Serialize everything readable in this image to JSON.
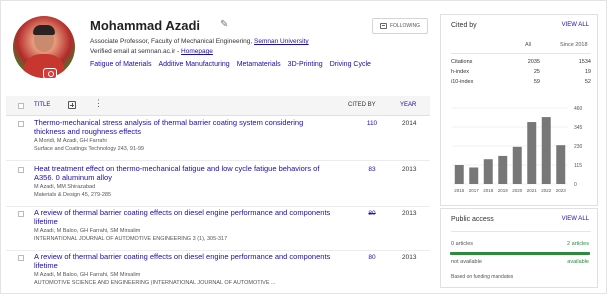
{
  "profile": {
    "name": "Mohammad Azadi",
    "affiliation_prefix": "Associate Professor, Faculty of Mechanical Engineering, ",
    "affiliation_link": "Semnan University",
    "verified_prefix": "Verified email at semnan.ac.ir - ",
    "homepage_label": "Homepage",
    "follow_label": "FOLLOWING",
    "interests": [
      "Fatigue of Materials",
      "Additive Manufacturing",
      "Metamaterials",
      "3D-Printing",
      "Driving Cycle"
    ]
  },
  "table": {
    "title_label": "TITLE",
    "cited_label": "CITED BY",
    "year_label": "YEAR",
    "rows": [
      {
        "title": "Thermo-mechanical stress analysis of thermal barrier coating system considering thickness and roughness effects",
        "authors": "A Moridi, M Azadi, GH Farrahi",
        "venue": "Surface and Coatings Technology 243, 91-99",
        "cited": "110",
        "year": "2014"
      },
      {
        "title": "Heat treatment effect on thermo-mechanical fatigue and low cycle fatigue behaviors of A356. 0 aluminum alloy",
        "authors": "M Azadi, MM Shirazabad",
        "venue": "Materials & Design 45, 279-285",
        "cited": "83",
        "year": "2013"
      },
      {
        "title": "A review of thermal barrier coating effects on diesel engine performance and components lifetime",
        "authors": "M Azadi, M Baloo, GH Farrahi, SM Mirsalim",
        "venue": "INTERNATIONAL JOURNAL OF AUTOMOTIVE ENGINEERING 3 (1), 305-317",
        "cited": "80",
        "year": "2013"
      },
      {
        "title": "A review of thermal barrier coating effects on diesel engine performance and components lifetime",
        "authors": "M Azadi, M Baloo, GH Farrahi, SM Mirsalim",
        "venue": "AUTOMOTIVE SCIENCE AND ENGINEERING (INTERNATIONAL JOURNAL OF AUTOMOTIVE ...",
        "cited": "80",
        "year": "2013"
      }
    ]
  },
  "cited_by": {
    "title": "Cited by",
    "view_all": "VIEW ALL",
    "col_all": "All",
    "col_since": "Since 2018",
    "metrics": [
      {
        "label": "Citations",
        "all": "2035",
        "since": "1534"
      },
      {
        "label": "h-index",
        "all": "25",
        "since": "19"
      },
      {
        "label": "i10-index",
        "all": "59",
        "since": "52"
      }
    ]
  },
  "chart_data": {
    "type": "bar",
    "categories": [
      "2016",
      "2017",
      "2018",
      "2019",
      "2020",
      "2021",
      "2022",
      "2023"
    ],
    "values": [
      115,
      100,
      150,
      170,
      225,
      375,
      405,
      235
    ],
    "yticks": [
      "460",
      "345",
      "230",
      "115",
      "0"
    ],
    "ylim": [
      0,
      460
    ],
    "bar_color": "#777777"
  },
  "public_access": {
    "title": "Public access",
    "view_all": "VIEW ALL",
    "left_label": "0 articles",
    "right_label": "2 articles",
    "not_available": "not available",
    "available": "available",
    "available_fraction": 1.0,
    "footer": "Based on funding mandates"
  }
}
